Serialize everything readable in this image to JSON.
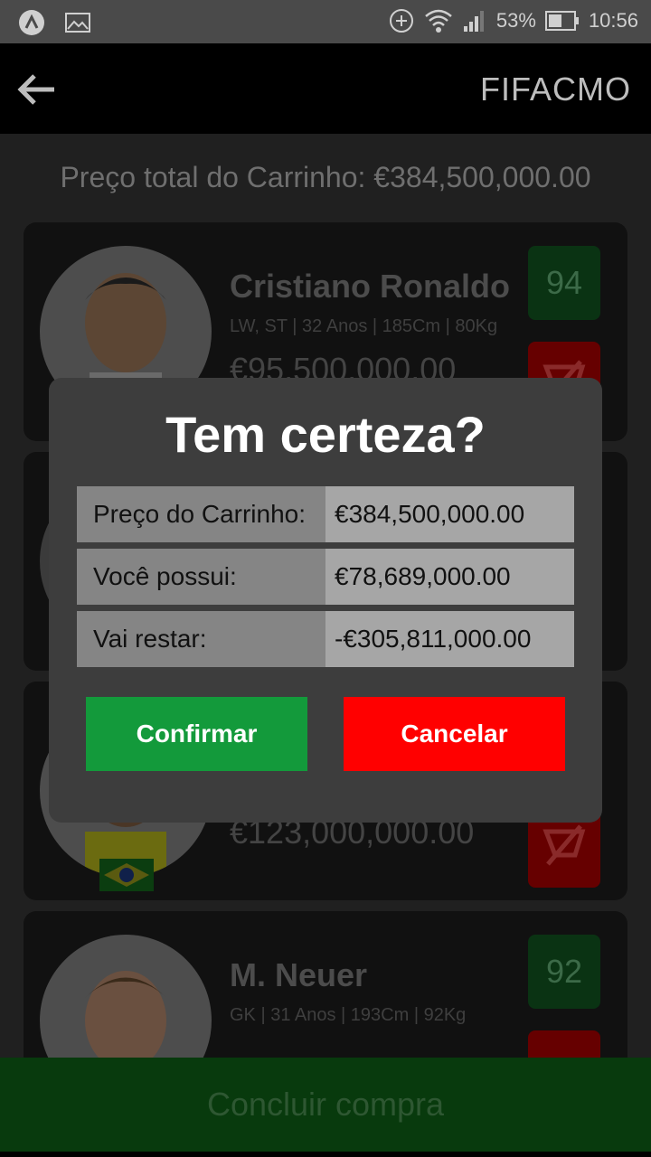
{
  "statusbar": {
    "battery": "53%",
    "time": "10:56"
  },
  "appbar": {
    "title": "FIFACMO"
  },
  "cart": {
    "total_label": "Preço total do Carrinho: €384,500,000.00"
  },
  "players": [
    {
      "name": "Cristiano Ronaldo",
      "info": "LW, ST | 32 Anos | 185Cm | 80Kg",
      "price": "€95,500,000.00",
      "rating": "94"
    },
    {
      "name": "",
      "info": "",
      "price": "€123,000,000.00",
      "rating": ""
    },
    {
      "name": "M. Neuer",
      "info": "GK | 31 Anos | 193Cm | 92Kg",
      "price": "",
      "rating": "92"
    }
  ],
  "checkout": {
    "label": "Concluir compra"
  },
  "dialog": {
    "title": "Tem certeza?",
    "rows": [
      {
        "label": "Preço do Carrinho:",
        "value": "€384,500,000.00"
      },
      {
        "label": "Você possui:",
        "value": "€78,689,000.00"
      },
      {
        "label": "Vai restar:",
        "value": "-€305,811,000.00"
      }
    ],
    "confirm_label": "Confirmar",
    "cancel_label": "Cancelar"
  }
}
